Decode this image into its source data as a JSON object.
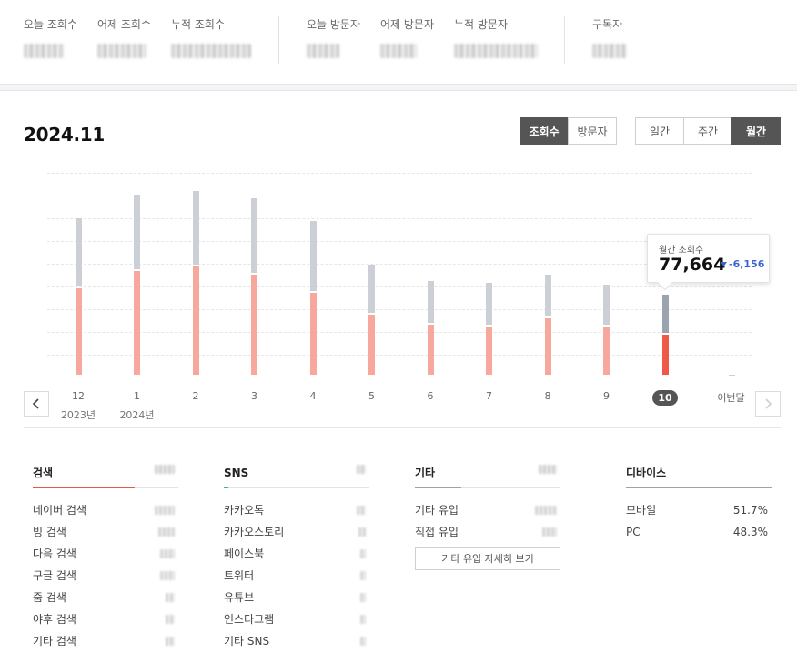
{
  "stats": {
    "groups": [
      {
        "items": [
          {
            "label": "오늘 조회수"
          },
          {
            "label": "어제 조회수"
          },
          {
            "label": "누적 조회수"
          }
        ]
      },
      {
        "items": [
          {
            "label": "오늘 방문자"
          },
          {
            "label": "어제 방문자"
          },
          {
            "label": "누적 방문자"
          }
        ]
      },
      {
        "items": [
          {
            "label": "구독자"
          }
        ]
      }
    ]
  },
  "chart_header": {
    "title": "2024.11",
    "metric_toggle": [
      "조회수",
      "방문자"
    ],
    "metric_active": "조회수",
    "period_toggle": [
      "일간",
      "주간",
      "월간"
    ],
    "period_active": "월간"
  },
  "chart_data": {
    "type": "bar",
    "categories": [
      "12",
      "1",
      "2",
      "3",
      "4",
      "5",
      "6",
      "7",
      "8",
      "9",
      "10",
      "이번달"
    ],
    "year_labels": {
      "12": "2023년",
      "1": "2024년"
    },
    "selected": "10",
    "tooltip": {
      "label": "월간 조회수",
      "value": "77,664",
      "delta": "-6,156",
      "delta_direction": "down"
    },
    "series": [
      {
        "values": [
          43,
          52,
          54,
          50,
          41,
          30,
          25,
          24,
          28,
          24,
          20,
          0
        ]
      },
      {
        "values": [
          78,
          90,
          92,
          88,
          77,
          55,
          47,
          46,
          50,
          45,
          40,
          0
        ]
      }
    ],
    "ylim": [
      0,
      100
    ],
    "grid": true
  },
  "colors": {
    "bar_total": "#ccd0d6",
    "bar_part": "#f7a79b",
    "bar_selected_total": "#9aa3ae",
    "bar_selected_part": "#f0584a",
    "accent_search": "#e8574a",
    "accent_sns": "#2ec27e",
    "accent_etc": "#9aa3ae",
    "accent_device": "#9aa3ae",
    "delta_down": "#3a64d8"
  },
  "breakdown": {
    "search": {
      "title": "검색",
      "bar_fraction": 0.7,
      "rows": [
        "네이버 검색",
        "빙 검색",
        "다음 검색",
        "구글 검색",
        "줌 검색",
        "야후 검색",
        "기타 검색"
      ]
    },
    "sns": {
      "title": "SNS",
      "bar_fraction": 0.03,
      "rows": [
        "카카오톡",
        "카카오스토리",
        "페이스북",
        "트위터",
        "유튜브",
        "인스타그램",
        "기타 SNS"
      ]
    },
    "etc": {
      "title": "기타",
      "bar_fraction": 0.32,
      "rows": [
        "기타 유입",
        "직접 유입"
      ],
      "detail_button": "기타 유입 자세히 보기"
    },
    "device": {
      "title": "디바이스",
      "bar_fraction": 1.0,
      "rows": [
        {
          "label": "모바일",
          "value": "51.7%"
        },
        {
          "label": "PC",
          "value": "48.3%"
        }
      ]
    }
  },
  "icons": {
    "prev": "chevron-left-icon",
    "next": "chevron-right-icon",
    "delta": "triangle-down-icon"
  }
}
